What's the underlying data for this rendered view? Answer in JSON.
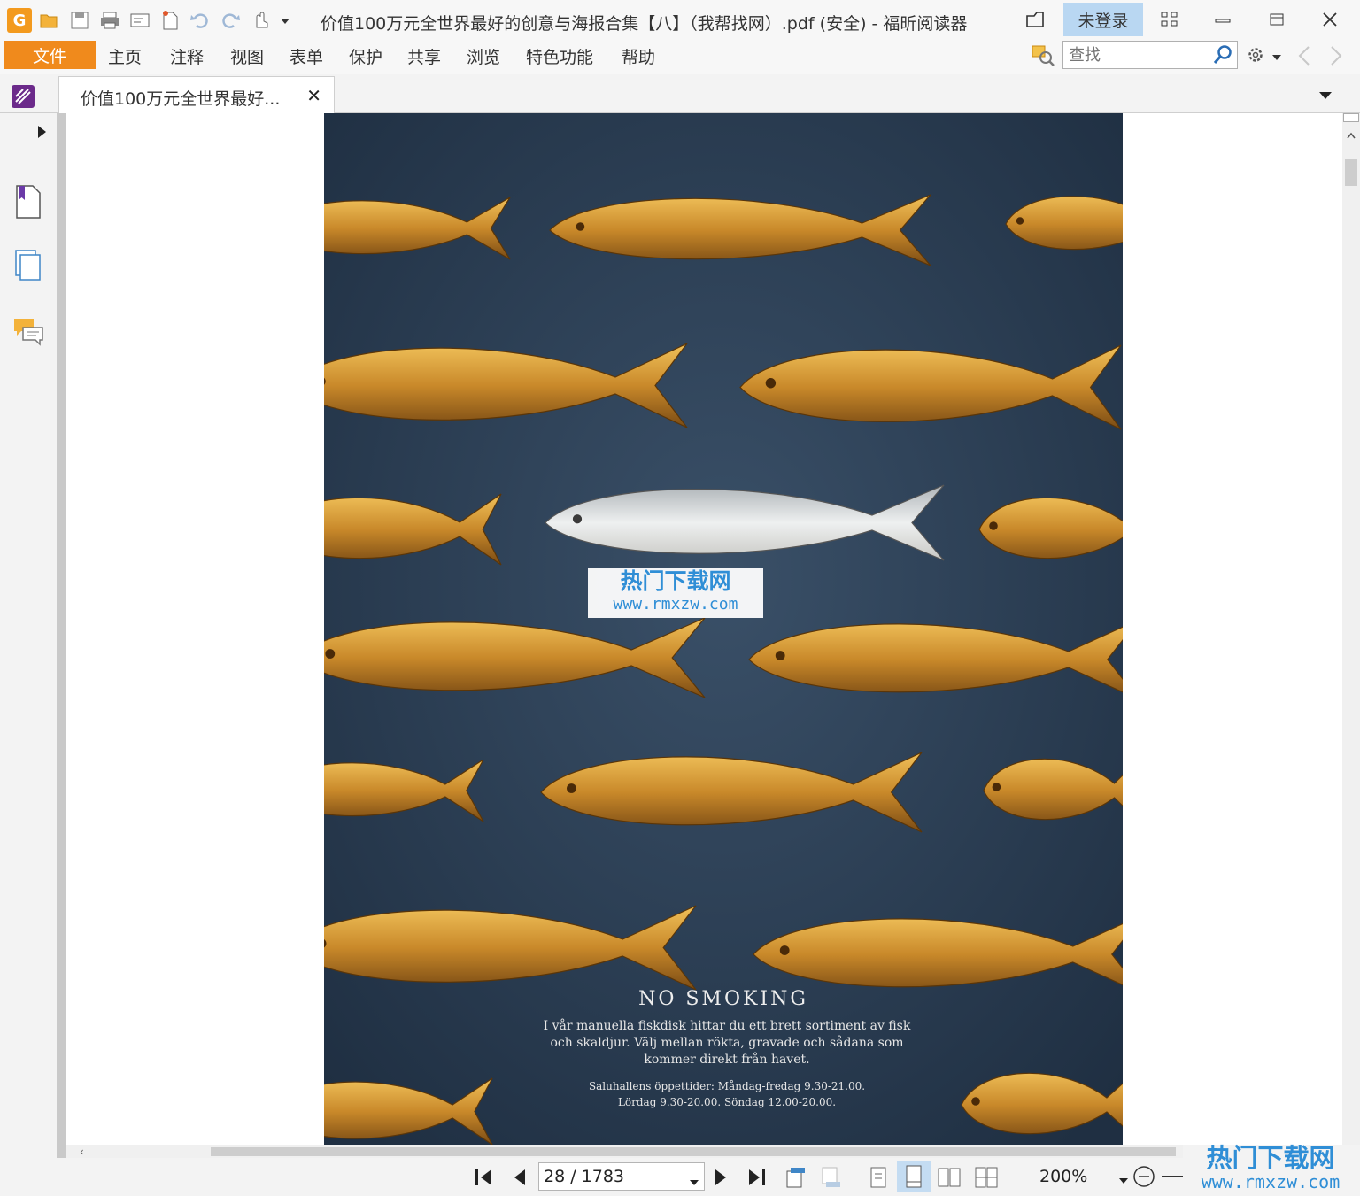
{
  "window": {
    "title": "价值100万元全世界最好的创意与海报合集【八】（我帮找网）.pdf (安全) - 福昕阅读器",
    "login_label": "未登录"
  },
  "menu": {
    "file": "文件",
    "items": [
      "主页",
      "注释",
      "视图",
      "表单",
      "保护",
      "共享",
      "浏览",
      "特色功能",
      "帮助"
    ]
  },
  "search": {
    "placeholder": "查找"
  },
  "tab": {
    "label": "价值100万元全世界最好..."
  },
  "poster": {
    "headline": "NO SMOKING",
    "body": "I vår manuella fiskdisk hittar du ett brett sortiment av fisk och skaldjur. Välj mellan rökta, gravade och sådana som kommer direkt från havet.",
    "hours_line1": "Saluhallens öppettider: Måndag-fredag 9.30-21.00.",
    "hours_line2": "Lördag 9.30-20.00. Söndag 12.00-20.00."
  },
  "status": {
    "page": "28 / 1783",
    "zoom": "200%"
  },
  "watermark": {
    "title": "热门下载网",
    "url": "www.rmxzw.com"
  },
  "colors": {
    "accent_orange": "#f08a1c",
    "login_blue": "#b9d7f2",
    "page_background": "#2b3d52",
    "fish_gold": "#c98a2a",
    "fish_silver": "#dadcdd"
  }
}
